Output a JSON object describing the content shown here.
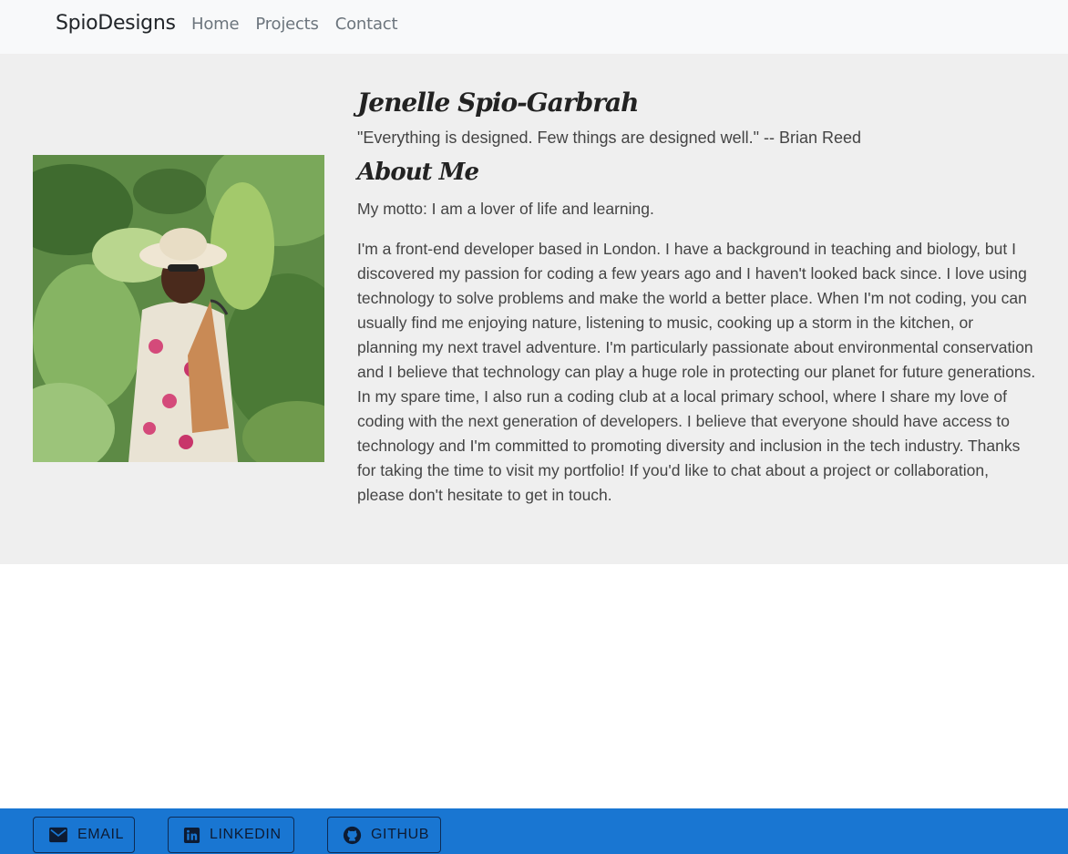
{
  "nav": {
    "brand": "SpioDesigns",
    "links": [
      "Home",
      "Projects",
      "Contact"
    ]
  },
  "about": {
    "name": "Jenelle Spio-Garbrah",
    "quote": "\"Everything is designed. Few things are designed well.\" -- Brian Reed",
    "section_title": "About Me",
    "motto": "My motto: I am a lover of life and learning.",
    "bio": "I'm a front-end developer based in London. I have a background in teaching and biology, but I discovered my passion for coding a few years ago and I haven't looked back since. I love using technology to solve problems and make the world a better place. When I'm not coding, you can usually find me enjoying nature, listening to music, cooking up a storm in the kitchen, or planning my next travel adventure. I'm particularly passionate about environmental conservation and I believe that technology can play a huge role in protecting our planet for future generations. In my spare time, I also run a coding club at a local primary school, where I share my love of coding with the next generation of developers. I believe that everyone should have access to technology and I'm committed to promoting diversity and inclusion in the tech industry. Thanks for taking the time to visit my portfolio! If you'd like to chat about a project or collaboration, please don't hesitate to get in touch."
  },
  "footer": {
    "email_label": "EMAIL",
    "linkedin_label": "LINKEDIN",
    "github_label": "GITHUB"
  },
  "colors": {
    "navbar_bg": "#f8f9fa",
    "section_bg": "#efefef",
    "footer_bg": "#1976d2"
  },
  "icons": [
    "email-icon",
    "linkedin-icon",
    "github-icon"
  ]
}
